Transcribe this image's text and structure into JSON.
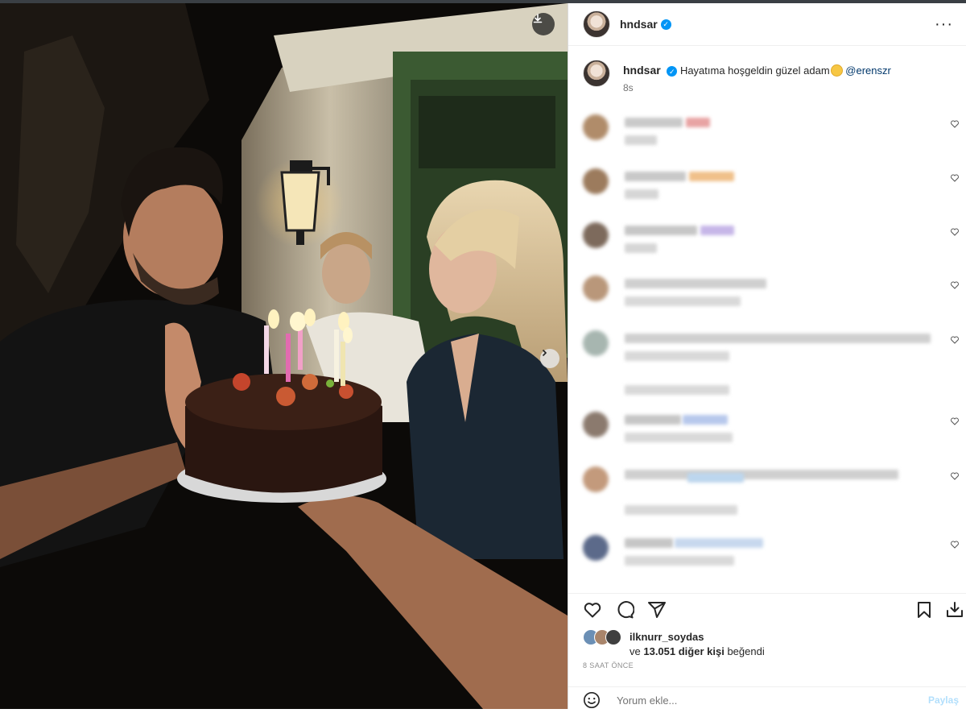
{
  "post": {
    "username": "hndsar",
    "caption_username": "hndsar",
    "caption_text": "Hayatıma hoşgeldin güzel adam",
    "caption_mention": "@erenszr",
    "caption_time": "8s",
    "liked_by": "ilknurr_soydas",
    "likes_prefix": "ve",
    "likes_count": "13.051 diğer kişi",
    "likes_suffix": "beğendi",
    "post_time": "8 SAAT ÖNCE"
  },
  "comment_form": {
    "placeholder": "Yorum ekle...",
    "share_label": "Paylaş"
  },
  "icons": {
    "download": "download-icon",
    "next": "chevron-right-icon",
    "more": "more-horizontal-icon",
    "like": "heart-icon",
    "comment": "comment-icon",
    "share": "send-icon",
    "save": "bookmark-icon",
    "save_to": "save-to-collection-icon",
    "emoji": "emoji-icon",
    "verified": "verified-badge-icon"
  },
  "colors": {
    "verified": "#0095f6",
    "mention": "#00376b",
    "muted": "#737373",
    "share_disabled": "#b2dffc"
  }
}
